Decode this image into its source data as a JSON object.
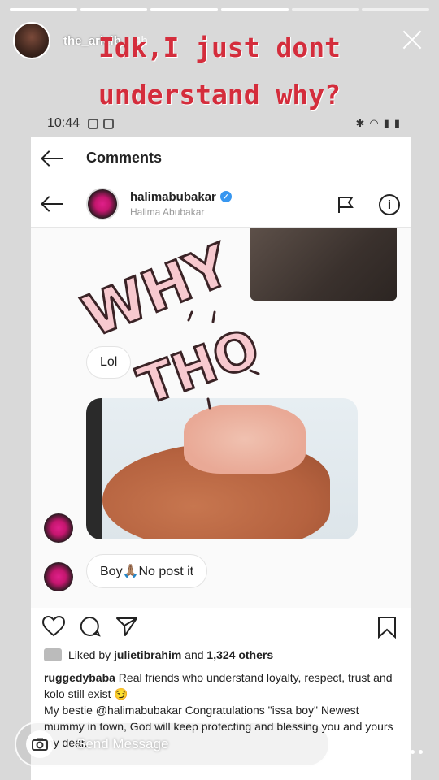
{
  "story": {
    "username": "the_arielb_",
    "time_ago": "4h",
    "overlay_line1": "Idk,I just dont",
    "overlay_line2": "understand why?",
    "send_placeholder": "Send Message",
    "progress_segments": 6,
    "progress_done": 4
  },
  "statusbar": {
    "time": "10:44"
  },
  "comments_bar": {
    "title": "Comments"
  },
  "chat": {
    "username": "halimabubakar",
    "full_name": "Halima Abubakar",
    "messages": [
      {
        "text": "Lol"
      },
      {
        "text": "Boy🙏🏽No post it"
      }
    ],
    "sticker_line1": "WHY",
    "sticker_line2": "THO"
  },
  "post": {
    "liked_by_prefix": "Liked by",
    "liked_by_user": "julietibrahim",
    "liked_by_and": "and",
    "liked_by_count": "1,324 others",
    "caption_user": "ruggedybaba",
    "caption_text": "Real friends who understand loyalty, respect, trust and kolo still exist 😏",
    "caption_line2": "My bestie @halimabubakar Congratulations \"issa boy\" Newest mummy in town, God will keep protecting and blessing you and yours my dear."
  },
  "colors": {
    "overlay_text": "#d42d3c",
    "sticker_fill": "#f7c9cf",
    "verified_blue": "#3897f0"
  }
}
